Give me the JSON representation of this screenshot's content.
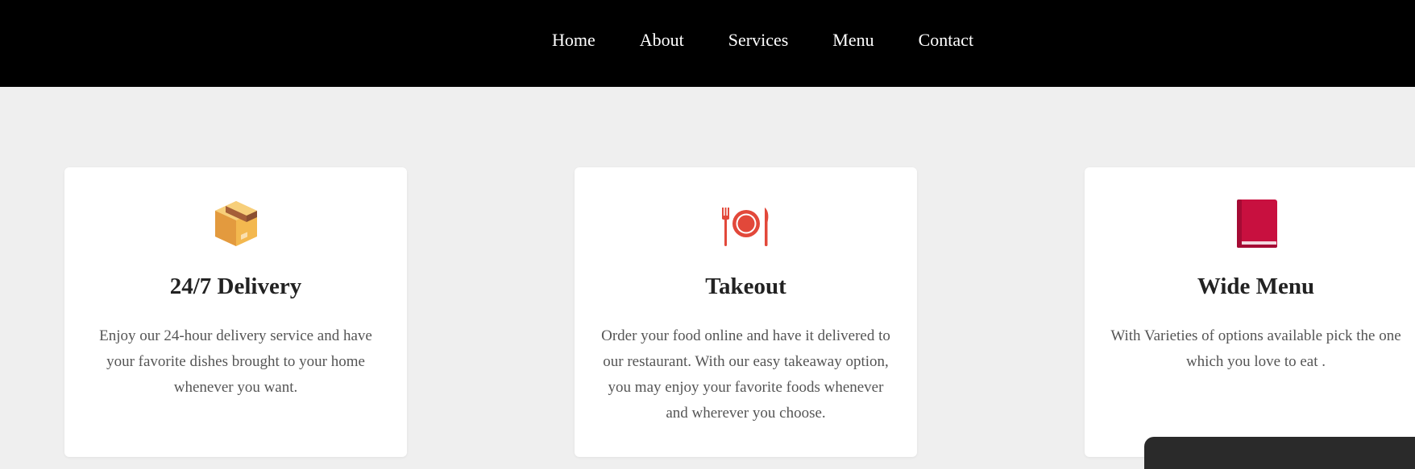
{
  "nav": {
    "items": [
      {
        "label": "Home"
      },
      {
        "label": "About"
      },
      {
        "label": "Services"
      },
      {
        "label": "Menu"
      },
      {
        "label": "Contact"
      }
    ]
  },
  "cards": [
    {
      "icon": "package-box-icon",
      "title": "24/7 Delivery",
      "description": "Enjoy our 24-hour delivery service and have your favorite dishes brought to your home whenever you want."
    },
    {
      "icon": "fork-plate-knife-icon",
      "title": "Takeout",
      "description": "Order your food online and have it delivered to our restaurant. With our easy takeaway option, you may enjoy your favorite foods whenever and wherever you choose."
    },
    {
      "icon": "red-book-icon",
      "title": "Wide Menu",
      "description": "With Varieties of options available pick the one which you love to eat ."
    }
  ],
  "colors": {
    "nav_background": "#000000",
    "page_background": "#efefef",
    "card_background": "#ffffff",
    "box_icon": "#e8a650",
    "plate_icon": "#e2483a",
    "book_icon": "#c8103f"
  }
}
